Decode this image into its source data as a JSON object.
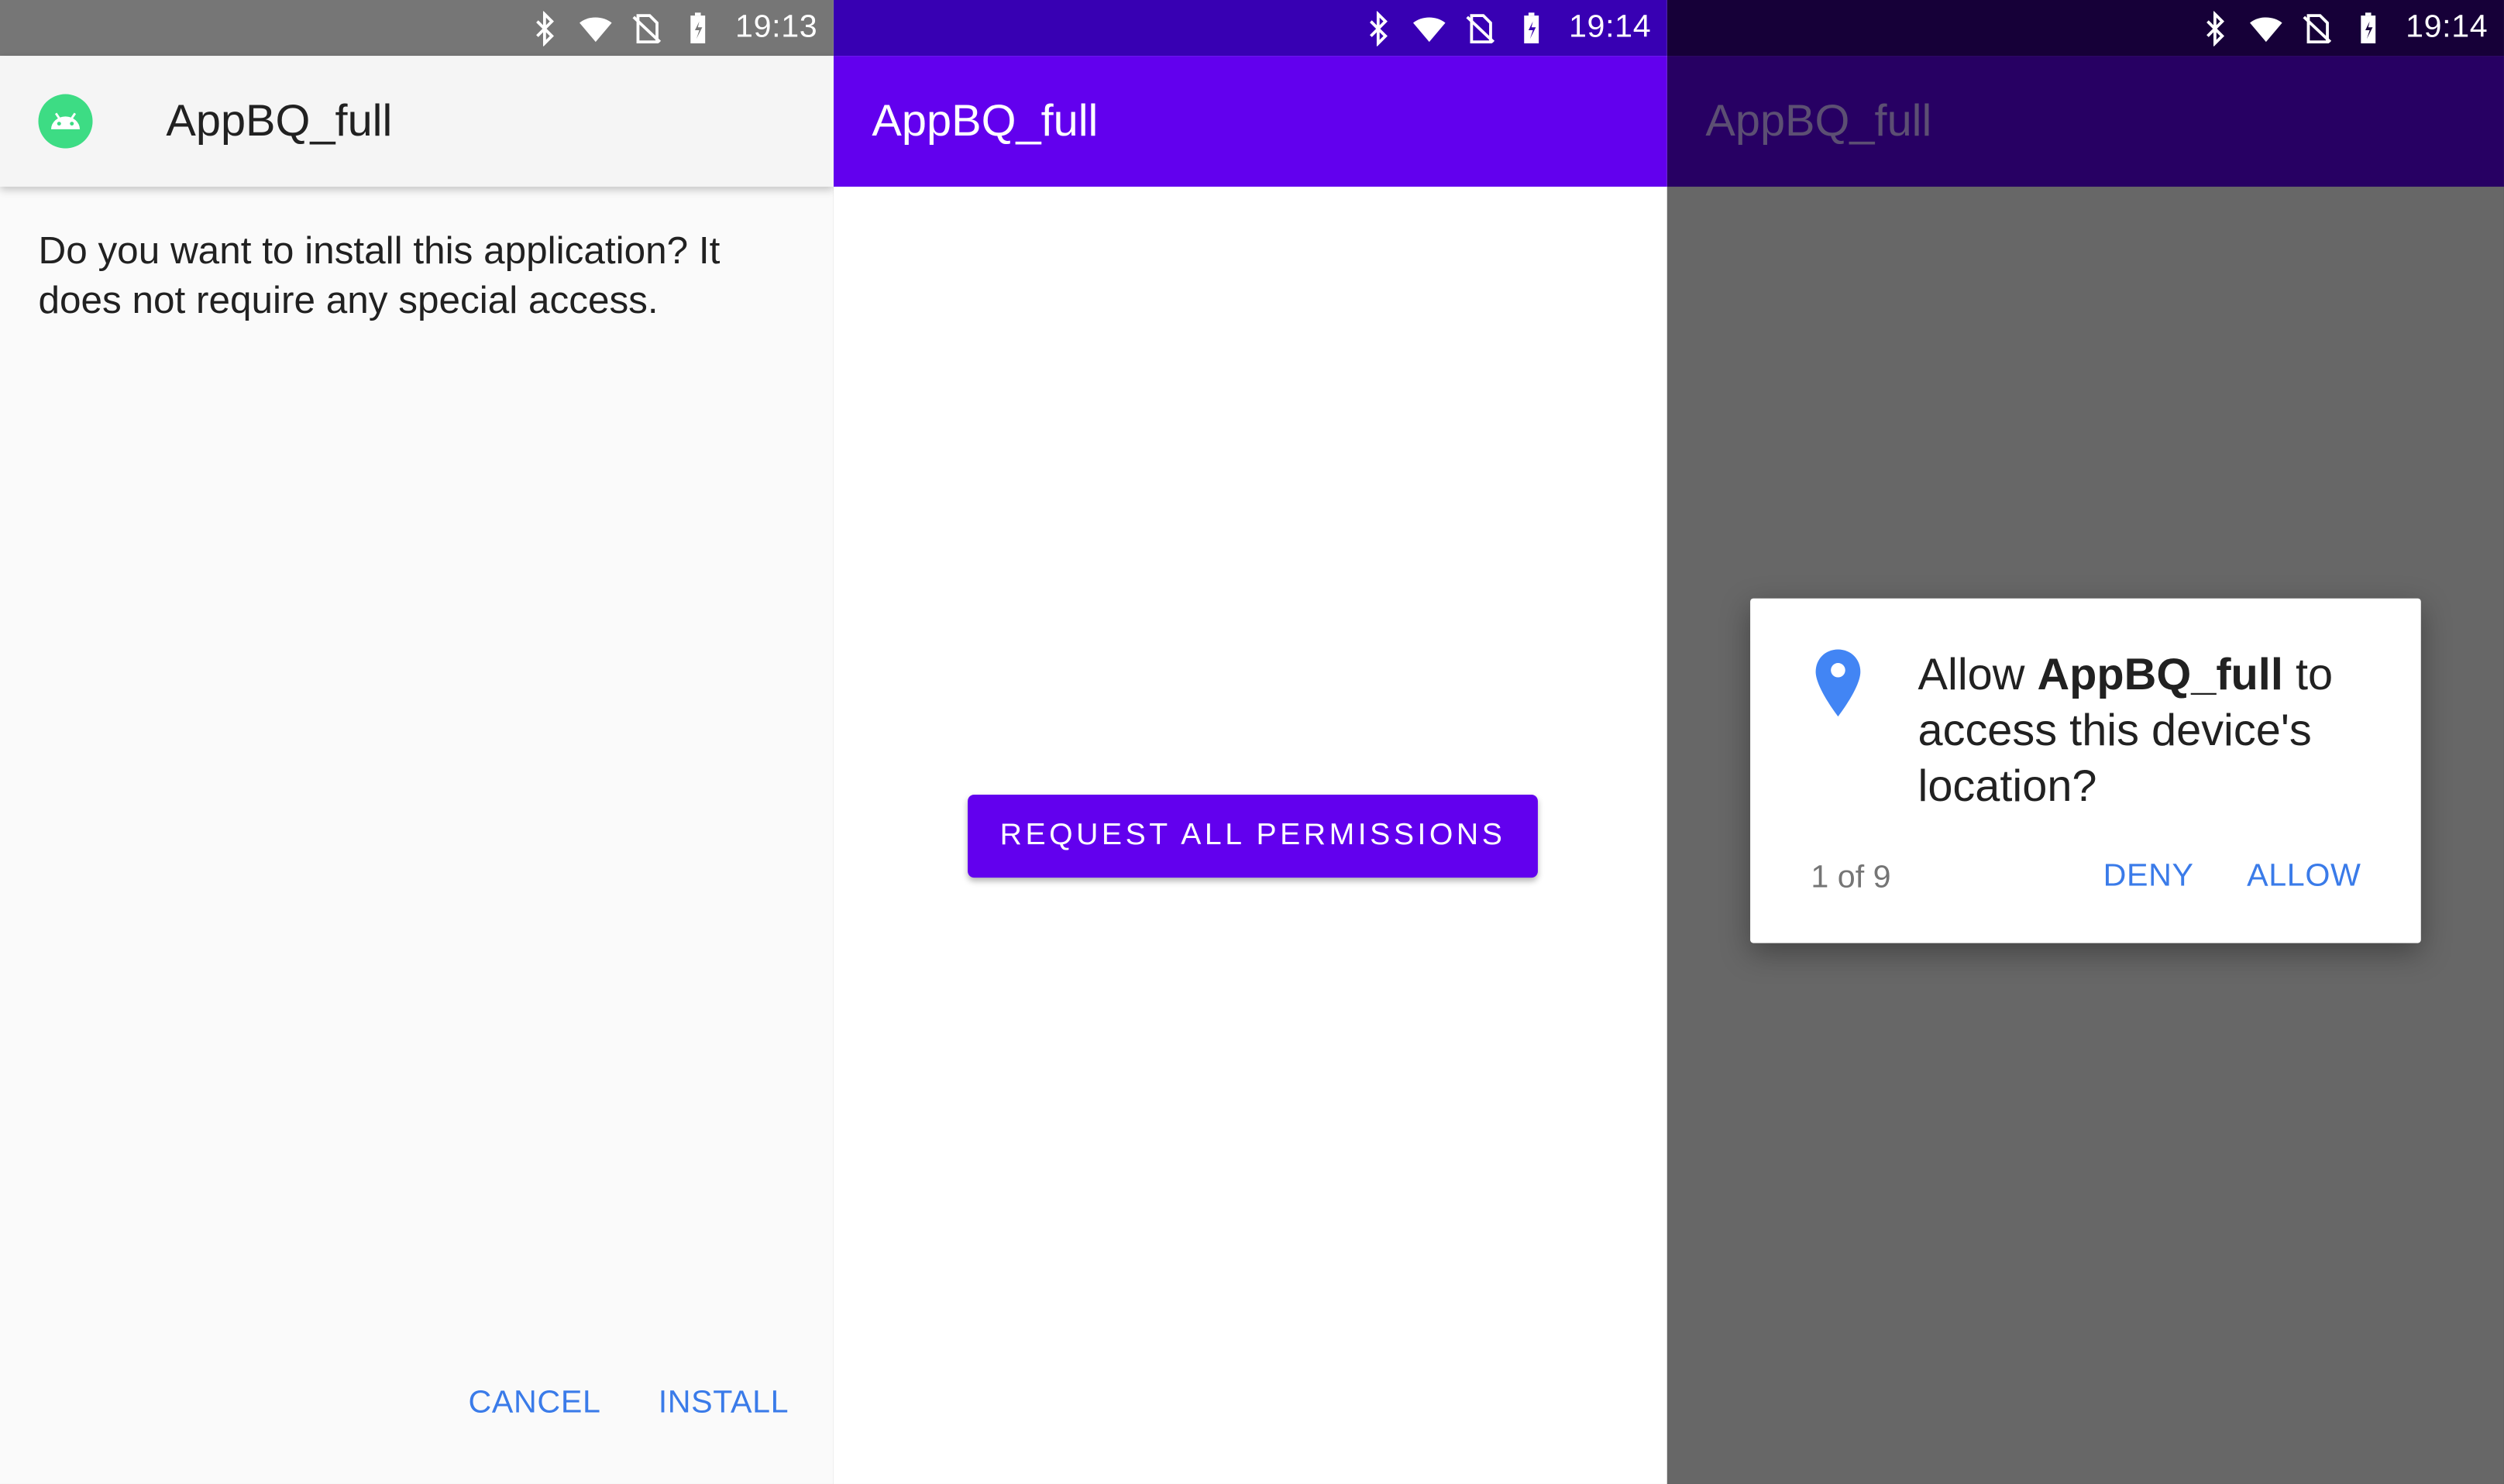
{
  "panels": [
    {
      "status_time": "19:13",
      "app_title": "AppBQ_full",
      "message": "Do you want to install this application? It does not require any special access.",
      "buttons": {
        "cancel": "CANCEL",
        "install": "INSTALL"
      }
    },
    {
      "status_time": "19:14",
      "app_title": "AppBQ_full",
      "button": "REQUEST ALL PERMISSIONS"
    },
    {
      "status_time": "19:14",
      "app_title": "AppBQ_full",
      "dialog": {
        "prefix": "Allow ",
        "app_name": "AppBQ_full",
        "suffix": " to access this device's location?",
        "counter": "1 of 9",
        "deny": "DENY",
        "allow": "ALLOW"
      }
    }
  ],
  "icons": {
    "status": [
      "bluetooth-icon",
      "wifi-icon",
      "no-sim-icon",
      "battery-charging-icon"
    ],
    "app": "android-app-icon",
    "dialog": "location-pin-icon"
  },
  "colors": {
    "panel1_statusbar": "#767676",
    "panel2_statusbar": "#3800b3",
    "panel2_appbar": "#6200ee",
    "panel3_statusbar": "#160038",
    "panel3_appbar": "#270063",
    "accent_text_button": "#3a7be9",
    "location_icon": "#4285f4",
    "android_icon": "#3ddc84"
  }
}
